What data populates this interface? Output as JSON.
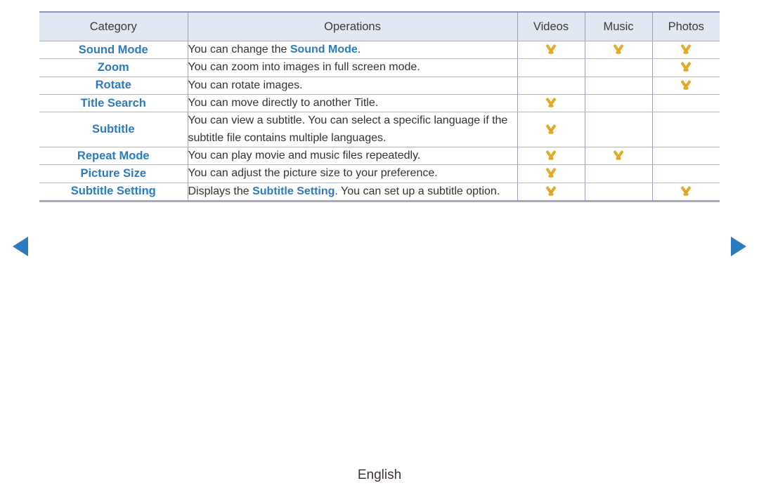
{
  "nav": {
    "prev_icon": "triangle-left-icon",
    "next_icon": "triangle-right-icon",
    "arrow_color": "#2c7bbf"
  },
  "table": {
    "headers": [
      "Category",
      "Operations",
      "Videos",
      "Music",
      "Photos"
    ],
    "check_icon": "chevron-check-icon",
    "check_color": "#e0ab2b",
    "link_color": "#2c7bbf",
    "header_background": "#e2e8f2",
    "rows": [
      {
        "category": "Sound Mode",
        "operation_pre": "You can change the ",
        "operation_link": "Sound Mode",
        "operation_post": ".",
        "videos": true,
        "music": true,
        "photos": true
      },
      {
        "category": "Zoom",
        "operation_pre": "You can zoom into images in full screen mode.",
        "operation_link": "",
        "operation_post": "",
        "videos": false,
        "music": false,
        "photos": true
      },
      {
        "category": "Rotate",
        "operation_pre": "You can rotate images.",
        "operation_link": "",
        "operation_post": "",
        "videos": false,
        "music": false,
        "photos": true
      },
      {
        "category": "Title Search",
        "operation_pre": "You can move directly to another Title.",
        "operation_link": "",
        "operation_post": "",
        "videos": true,
        "music": false,
        "photos": false
      },
      {
        "category": "Subtitle",
        "operation_pre": "You can view a subtitle. You can select a specific language if the subtitle file contains multiple languages.",
        "operation_link": "",
        "operation_post": "",
        "videos": true,
        "music": false,
        "photos": false
      },
      {
        "category": "Repeat Mode",
        "operation_pre": "You can play movie and music files repeatedly.",
        "operation_link": "",
        "operation_post": "",
        "videos": true,
        "music": true,
        "photos": false
      },
      {
        "category": "Picture Size",
        "operation_pre": "You can adjust the picture size to your preference.",
        "operation_link": "",
        "operation_post": "",
        "videos": true,
        "music": false,
        "photos": false
      },
      {
        "category": "Subtitle Setting",
        "operation_pre": "Displays the ",
        "operation_link": "Subtitle Setting",
        "operation_post": ". You can set up a subtitle option.",
        "videos": true,
        "music": false,
        "photos": true
      }
    ]
  },
  "footer": {
    "language": "English"
  }
}
